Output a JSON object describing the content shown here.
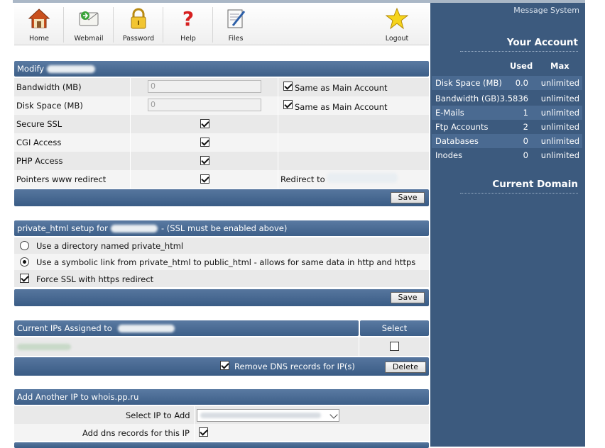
{
  "toolbar": {
    "home": "Home",
    "webmail": "Webmail",
    "password": "Password",
    "help": "Help",
    "files": "Files",
    "logout": "Logout"
  },
  "account": {
    "message_system": "Message System",
    "your_account": "Your Account",
    "col_used": "Used",
    "col_max": "Max",
    "rows": [
      {
        "label": "Disk Space (MB)",
        "used": "0.0",
        "max": "unlimited"
      },
      {
        "label": "Bandwidth (GB)",
        "used": "3.5836",
        "max": "unlimited"
      },
      {
        "label": "E-Mails",
        "used": "1",
        "max": "unlimited"
      },
      {
        "label": "Ftp Accounts",
        "used": "2",
        "max": "unlimited"
      },
      {
        "label": "Databases",
        "used": "0",
        "max": "unlimited"
      },
      {
        "label": "Inodes",
        "used": "0",
        "max": "unlimited"
      }
    ],
    "current_domain": "Current Domain"
  },
  "modify": {
    "header": "Modify",
    "bandwidth_label": "Bandwidth (MB)",
    "bandwidth_value": "0",
    "bandwidth_same": "Same as Main Account",
    "disk_label": "Disk Space (MB)",
    "disk_value": "0",
    "disk_same": "Same as Main Account",
    "ssl_label": "Secure SSL",
    "cgi_label": "CGI Access",
    "php_label": "PHP Access",
    "pointers_label": "Pointers www redirect",
    "redirect_to": "Redirect to",
    "save": "Save"
  },
  "private_html": {
    "header_prefix": "private_html setup for",
    "header_suffix": "- (SSL must be enabled above)",
    "option_dir": "Use a directory named private_html",
    "option_link": "Use a symbolic link from private_html to public_html - allows for same data in http and https",
    "force_ssl": "Force SSL with https redirect",
    "save": "Save"
  },
  "ips": {
    "header": "Current IPs Assigned to",
    "select_col": "Select",
    "remove_dns": "Remove DNS records for IP(s)",
    "delete": "Delete"
  },
  "add_ip": {
    "header": "Add Another IP to whois.pp.ru",
    "select_label": "Select IP to Add",
    "dns_label": "Add dns records for this IP"
  }
}
